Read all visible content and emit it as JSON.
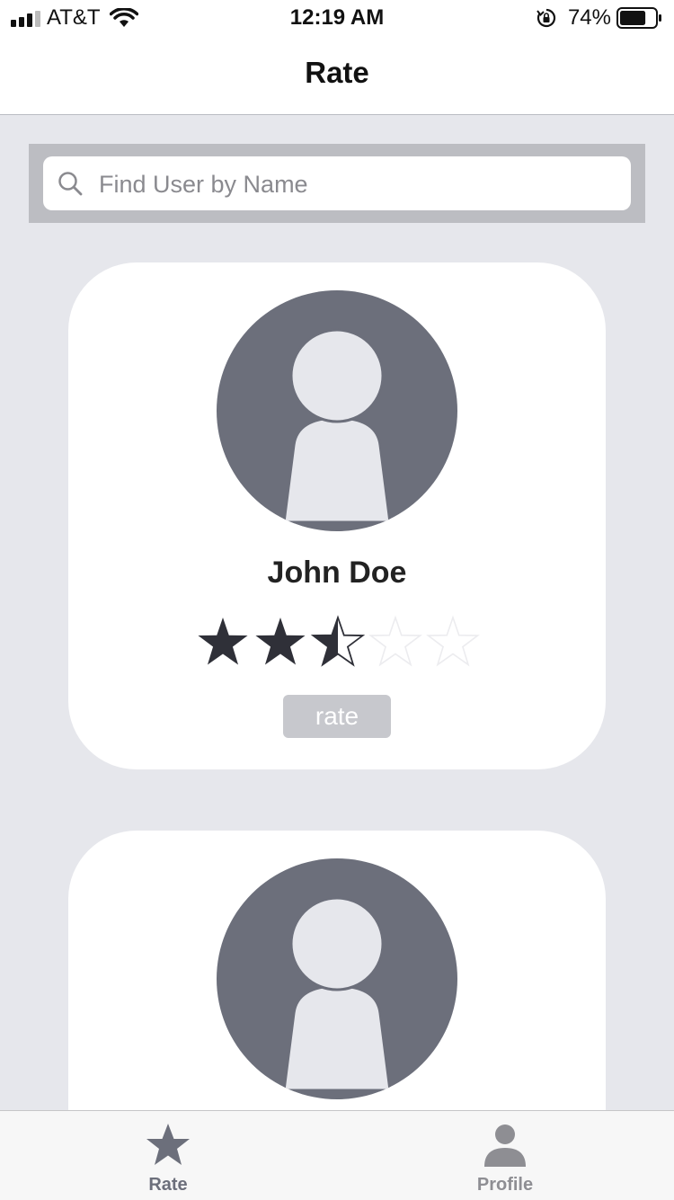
{
  "status_bar": {
    "carrier": "AT&T",
    "time": "12:19 AM",
    "battery_percent": "74%",
    "battery_level": 0.74,
    "icons": [
      "signal-icon",
      "wifi-icon",
      "rotation-lock-icon",
      "battery-icon"
    ]
  },
  "nav": {
    "title": "Rate"
  },
  "search": {
    "placeholder": "Find User by Name",
    "value": ""
  },
  "cards": [
    {
      "name": "John Doe",
      "rating": 2.5,
      "rating_max": 5,
      "button_label": "rate"
    },
    {
      "name": "",
      "rating": null
    }
  ],
  "tabs": [
    {
      "label": "Rate",
      "icon": "star-icon",
      "active": true
    },
    {
      "label": "Profile",
      "icon": "person-icon",
      "active": false
    }
  ],
  "colors": {
    "background": "#e6e7ec",
    "avatar_bg": "#6c6f7b",
    "avatar_fg": "#e6e7ec",
    "star_filled": "#2f3038",
    "rate_button": "#c7c8cd",
    "tab_active": "#6c6f7b",
    "tab_inactive": "#8e8e93"
  }
}
